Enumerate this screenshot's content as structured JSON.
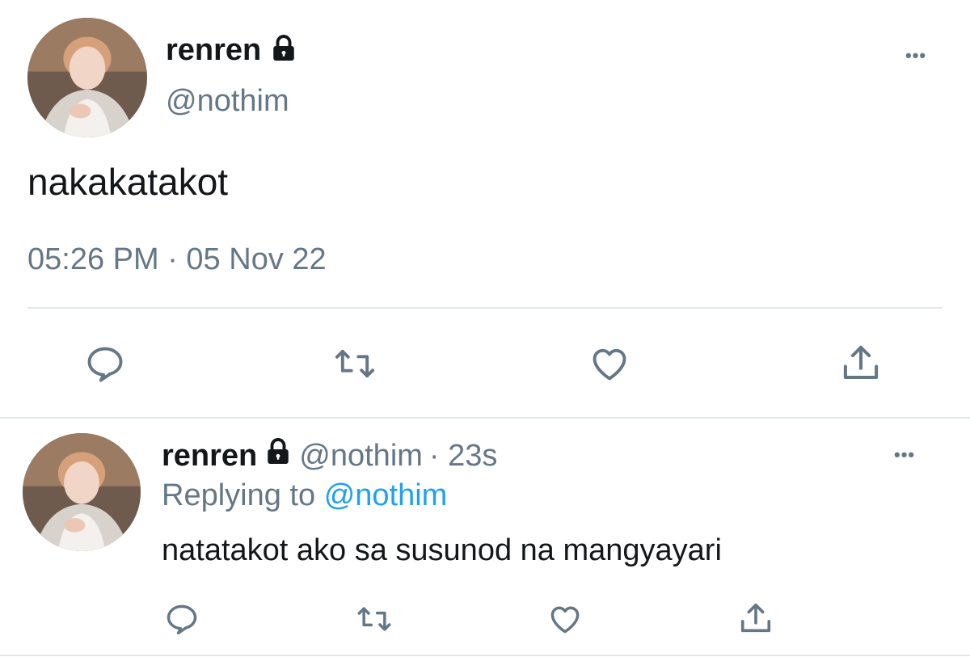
{
  "main_tweet": {
    "display_name": "renren",
    "handle": "@nothim",
    "text": "nakakatakot",
    "timestamp": "05:26 PM · 05 Nov 22",
    "more_label": "•••"
  },
  "reply_tweet": {
    "display_name": "renren",
    "handle": "@nothim",
    "age": "· 23s",
    "replying_prefix": "Replying to",
    "replying_handle": "@nothim",
    "text": "natatakot ako sa susunod na mangyayari",
    "more_label": "•••"
  },
  "icons": [
    "reply-icon",
    "retweet-icon",
    "like-icon",
    "share-icon",
    "lock-icon",
    "more-icon"
  ],
  "colors": {
    "text": "#14171a",
    "muted": "#657786",
    "link": "#1da1f2",
    "divider": "#e1e8ed"
  }
}
